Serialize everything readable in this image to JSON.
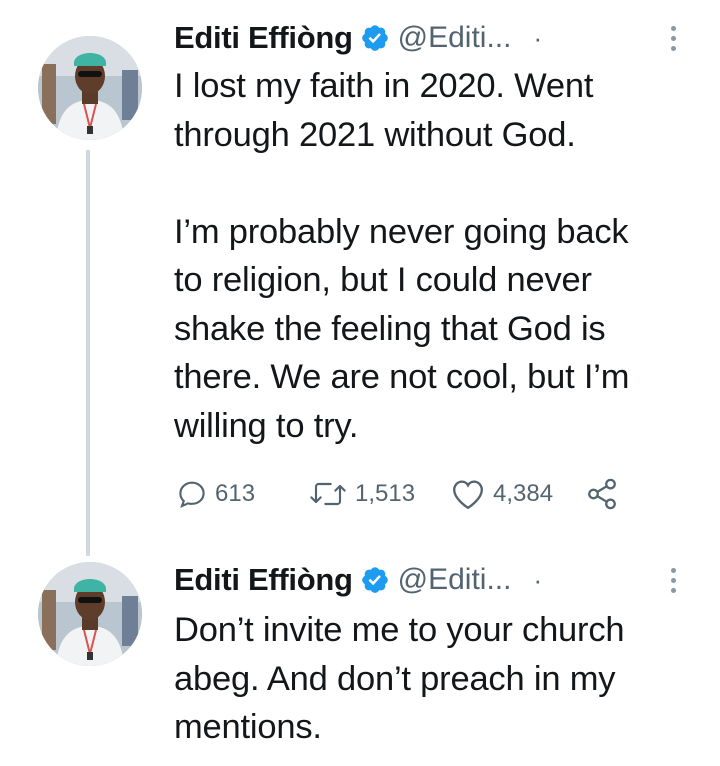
{
  "tweets": [
    {
      "author_name": "Editi Effiòng",
      "handle": "@Editi...",
      "separator": "·",
      "text": "I lost my faith in 2020. Went\nthrough 2021 without God.\n\nI’m probably never going back\nto religion, but I could never\nshake the feeling that God is\nthere. We are not cool, but I’m\nwilling to try.",
      "reply_count": "613",
      "retweet_count": "1,513",
      "like_count": "4,384",
      "icons": [
        "reply-icon",
        "retweet-icon",
        "like-icon",
        "share-icon"
      ]
    },
    {
      "author_name": "Editi Effiòng",
      "handle": "@Editi...",
      "separator": "·",
      "text": "Don’t invite me to your church\nabeg. And don’t preach in my\nmentions."
    }
  ],
  "colors": {
    "text": "#14171a",
    "secondary": "#536471",
    "verified": "#1d9bf0",
    "thread_line": "#cfd9de"
  }
}
